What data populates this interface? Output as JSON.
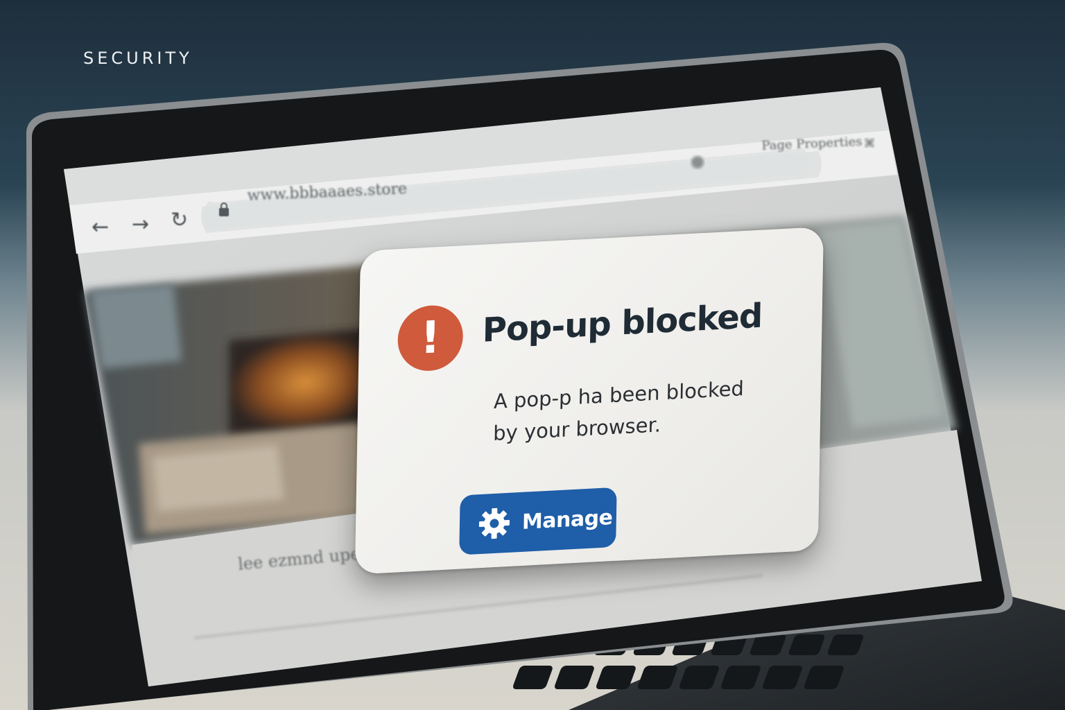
{
  "header": {
    "section_label": "SECURITY"
  },
  "browser": {
    "url": "www.bbbaaaes.store",
    "tab_text": "Page Properties",
    "page_caption": "lee ezmnd upen de-wsee",
    "nav_back_icon": "arrow-left-icon",
    "nav_forward_icon": "arrow-right-icon",
    "reload_icon": "reload-icon",
    "lock_icon": "lock-icon"
  },
  "popup": {
    "icon": "alert-icon",
    "icon_glyph": "!",
    "title": "Pop-up blocked",
    "message_line1": "A pop-p ha been blocked",
    "message_line2": "by your browser.",
    "button_icon": "gear-icon",
    "button_label": "Manage"
  },
  "colors": {
    "alert": "#cf5a3c",
    "accent": "#1f5ea8",
    "title": "#1f2b35"
  }
}
